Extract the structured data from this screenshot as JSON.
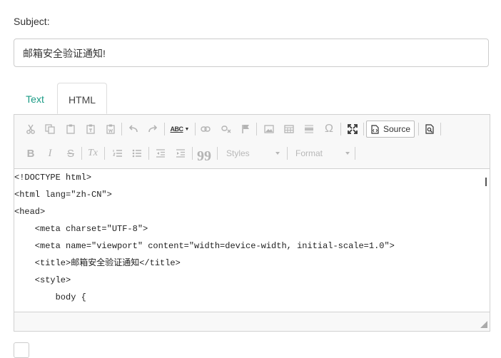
{
  "subject": {
    "label": "Subject:",
    "value": "邮箱安全验证通知!"
  },
  "tabs": [
    {
      "label": "Text",
      "active": false
    },
    {
      "label": "HTML",
      "active": true
    }
  ],
  "toolbar": {
    "source_label": "Source",
    "styles_label": "Styles",
    "format_label": "Format",
    "spellcheck_label": "ABC",
    "bold_label": "B",
    "italic_label": "I",
    "strike_label": "S",
    "remove_format_label": "Tx",
    "omega_label": "Ω",
    "blockquote_label": "99"
  },
  "code_lines": [
    "<!DOCTYPE html>",
    "<html lang=\"zh-CN\">",
    "<head>",
    "    <meta charset=\"UTF-8\">",
    "    <meta name=\"viewport\" content=\"width=device-width, initial-scale=1.0\">",
    "    <title>邮箱安全验证通知</title>",
    "    <style>",
    "        body {"
  ],
  "colors": {
    "accent": "#1a9b85",
    "toolbar_bg": "#f8f8f8",
    "border": "#d1d1d1",
    "disabled_icon": "#b4b4b4"
  }
}
